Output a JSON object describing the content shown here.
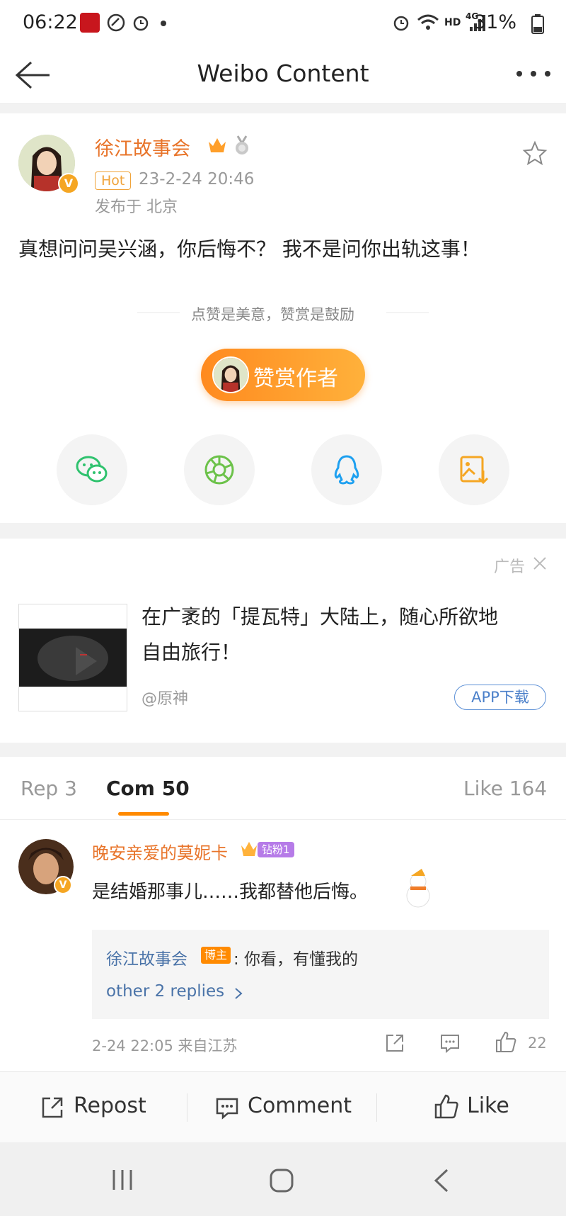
{
  "status": {
    "time": "06:22",
    "hd": "HD",
    "net": "4G",
    "battery": "31%"
  },
  "header": {
    "title": "Weibo Content"
  },
  "post": {
    "author": "徐江故事会",
    "hot_tag": "Hot",
    "datetime": "23-2-24 20:46",
    "location": "发布于 北京",
    "text": "真想问问吴兴涵，你后悔不？ 我不是问你出轨这事！",
    "reward_slogan": "点赞是美意，赞赏是鼓励",
    "reward_button": "赞赏作者"
  },
  "share": {
    "icons": [
      "wechat-icon",
      "moments-icon",
      "qq-icon",
      "save-image-icon"
    ]
  },
  "ad": {
    "label": "广告",
    "text_line1": "在广袤的「提瓦特」大陆上，随心所欲地",
    "text_line2": "自由旅行！",
    "source": "@原神",
    "button": "APP下载"
  },
  "tabs": {
    "repost": "Rep 3",
    "comment": "Com 50",
    "like": "Like 164"
  },
  "comment": {
    "author": "晚安亲爱的莫妮卡",
    "fan_badge": "钻粉1",
    "text": "是结婚那事儿……我都替他后悔。",
    "reply_author": "徐江故事会",
    "blogger_tag": "博主",
    "reply_text": ": 你看，有懂我的",
    "more_replies": "other 2 replies",
    "meta": "2-24 22:05  来自江苏",
    "like_count": "22"
  },
  "bottom": {
    "repost": "Repost",
    "comment": "Comment",
    "like": "Like"
  },
  "colors": {
    "accent": "#ff8a00",
    "username": "#e8742a",
    "link": "#4a73a8"
  }
}
